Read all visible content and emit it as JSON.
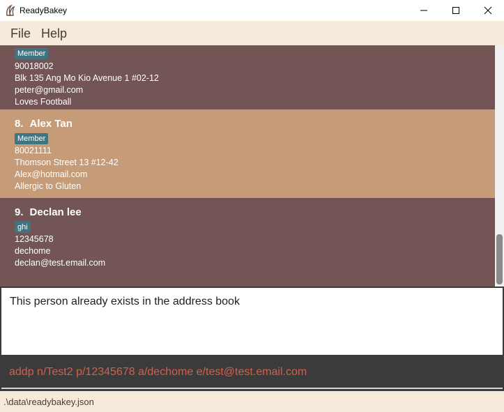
{
  "window": {
    "title": "ReadyBakey"
  },
  "menu": {
    "file": "File",
    "help": "Help"
  },
  "persons": [
    {
      "tags": [
        "Member"
      ],
      "phone": "90018002",
      "address": "Blk 135 Ang Mo Kio Avenue 1 #02-12",
      "email": "peter@gmail.com",
      "remark": "Loves Football"
    },
    {
      "index": "8.",
      "name": "Alex Tan",
      "tags": [
        "Member"
      ],
      "phone": "80021111",
      "address": "Thomson Street 13 #12-42",
      "email": "Alex@hotmail.com",
      "remark": "Allergic to Gluten"
    },
    {
      "index": "9.",
      "name": "Declan lee",
      "tags": [
        "ghi"
      ],
      "phone": "12345678",
      "address": "dechome",
      "email": "declan@test.email.com"
    }
  ],
  "result": {
    "message": "This person already exists in the address book"
  },
  "command": {
    "value": "addp n/Test2 p/12345678 a/dechome e/test@test.email.com"
  },
  "status": {
    "file_path": ".\\data\\readybakey.json"
  },
  "colors": {
    "card_dark": "#735555",
    "card_selected": "#c69b78",
    "tag": "#3f7582",
    "menu_bg": "#f6ebda",
    "command_bg": "#3b3b3b",
    "command_text": "#d2604a"
  },
  "icons": {
    "app": "bakery-logo-icon",
    "minimize": "minimize-icon",
    "maximize": "maximize-icon",
    "close": "close-icon"
  }
}
